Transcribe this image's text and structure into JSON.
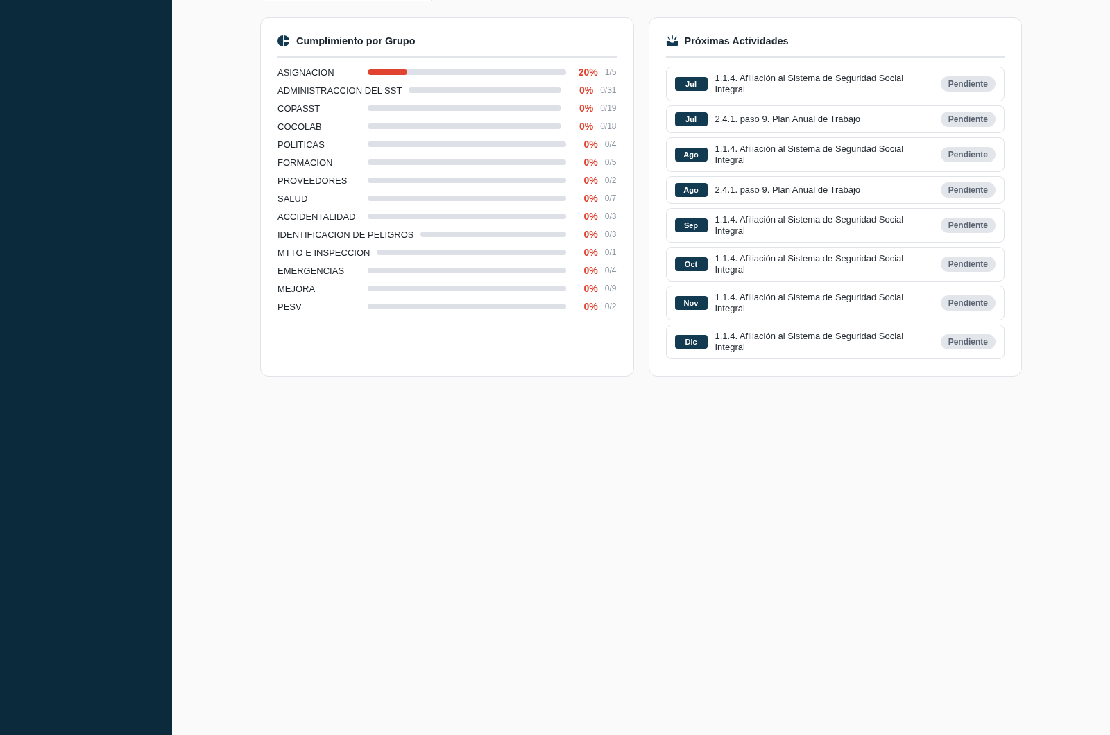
{
  "compliance_card": {
    "title": "Cumplimiento por Grupo",
    "groups": [
      {
        "name": "ASIGNACION",
        "level": 0.2,
        "percent": "20%",
        "count": "1/5"
      },
      {
        "name": "ADMINISTRACCION DEL SST",
        "level": 0,
        "percent": "0%",
        "count": "0/31"
      },
      {
        "name": "COPASST",
        "level": 0,
        "percent": "0%",
        "count": "0/19"
      },
      {
        "name": "COCOLAB",
        "level": 0,
        "percent": "0%",
        "count": "0/18"
      },
      {
        "name": "POLITICAS",
        "level": 0,
        "percent": "0%",
        "count": "0/4"
      },
      {
        "name": "FORMACION",
        "level": 0,
        "percent": "0%",
        "count": "0/5"
      },
      {
        "name": "PROVEEDORES",
        "level": 0,
        "percent": "0%",
        "count": "0/2"
      },
      {
        "name": "SALUD",
        "level": 0,
        "percent": "0%",
        "count": "0/7"
      },
      {
        "name": "ACCIDENTALIDAD",
        "level": 0,
        "percent": "0%",
        "count": "0/3"
      },
      {
        "name": "IDENTIFICACION DE PELIGROS",
        "level": 0,
        "percent": "0%",
        "count": "0/3"
      },
      {
        "name": "MTTO E INSPECCION",
        "level": 0,
        "percent": "0%",
        "count": "0/1"
      },
      {
        "name": "EMERGENCIAS",
        "level": 0,
        "percent": "0%",
        "count": "0/4"
      },
      {
        "name": "MEJORA",
        "level": 0,
        "percent": "0%",
        "count": "0/9"
      },
      {
        "name": "PESV",
        "level": 0,
        "percent": "0%",
        "count": "0/2"
      }
    ]
  },
  "activities_card": {
    "title": "Próximas Actividades",
    "items": [
      {
        "month": "Jul",
        "text": "1.1.4. Afiliación al Sistema de Seguridad Social Integral",
        "status": "Pendiente"
      },
      {
        "month": "Jul",
        "text": "2.4.1. paso 9. Plan Anual de Trabajo",
        "status": "Pendiente"
      },
      {
        "month": "Ago",
        "text": "1.1.4. Afiliación al Sistema de Seguridad Social Integral",
        "status": "Pendiente"
      },
      {
        "month": "Ago",
        "text": "2.4.1. paso 9. Plan Anual de Trabajo",
        "status": "Pendiente"
      },
      {
        "month": "Sep",
        "text": "1.1.4. Afiliación al Sistema de Seguridad Social Integral",
        "status": "Pendiente"
      },
      {
        "month": "Oct",
        "text": "1.1.4. Afiliación al Sistema de Seguridad Social Integral",
        "status": "Pendiente"
      },
      {
        "month": "Nov",
        "text": "1.1.4. Afiliación al Sistema de Seguridad Social Integral",
        "status": "Pendiente"
      },
      {
        "month": "Dic",
        "text": "1.1.4. Afiliación al Sistema de Seguridad Social Integral",
        "status": "Pendiente"
      }
    ]
  }
}
